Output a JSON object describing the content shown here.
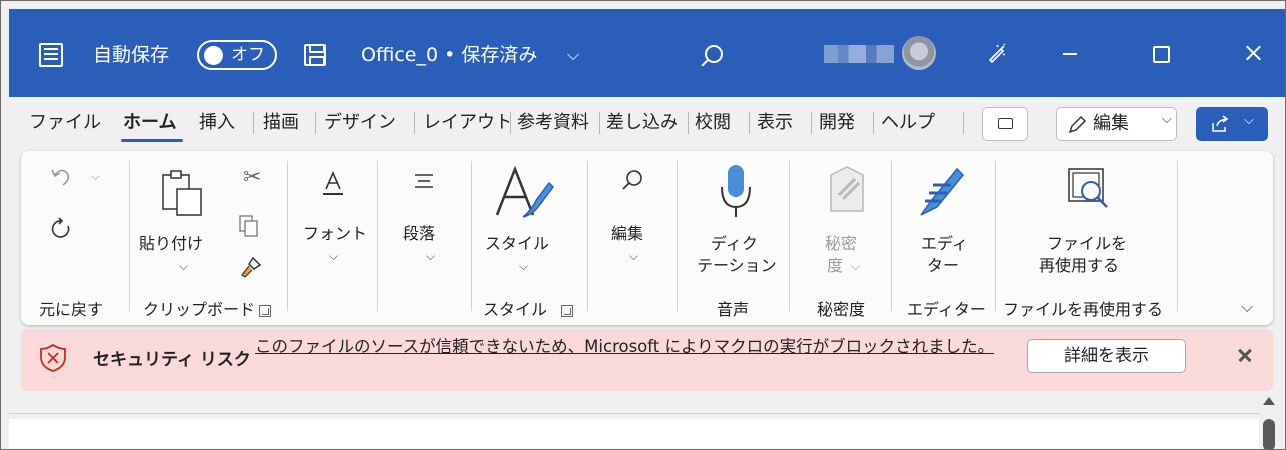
{
  "titlebar": {
    "autosave_label": "自動保存",
    "toggle_label": "オフ",
    "doc_title": "Office_0 • 保存済み",
    "doc_title_chevron": "⌵",
    "accent": "#2b5eb8"
  },
  "tabs": {
    "items": [
      "ファイル",
      "ホーム",
      "挿入",
      "描画",
      "デザイン",
      "レイアウト",
      "参考資料",
      "差し込み",
      "校閲",
      "表示",
      "開発",
      "ヘルプ"
    ],
    "active": "ホーム",
    "edit_label": "編集",
    "icons": [
      "comment-icon",
      "pencil-icon",
      "share-icon"
    ]
  },
  "ribbon": {
    "undo": {
      "group_label": "元に戻す"
    },
    "clipboard": {
      "paste_label": "貼り付け",
      "group_label": "クリップボード"
    },
    "font": {
      "label": "フォント"
    },
    "paragraph": {
      "label": "段落"
    },
    "styles": {
      "label": "スタイル",
      "group_label": "スタイル"
    },
    "editing": {
      "label": "編集"
    },
    "voice": {
      "label_line1": "ディク",
      "label_line2": "テーション",
      "group_label": "音声"
    },
    "sensitivity": {
      "label_line1": "秘密",
      "label_line2": "度",
      "group_label": "秘密度"
    },
    "editor": {
      "label_line1": "エディ",
      "label_line2": "ター",
      "group_label": "エディター"
    },
    "reuse": {
      "label_line1": "ファイルを",
      "label_line2": "再使用する",
      "group_label": "ファイルを再使用する"
    }
  },
  "security": {
    "title": "セキュリティ リスク",
    "message": "このファイルのソースが信頼できないため、Microsoft によりマクロの実行がブロックされました。",
    "details_button": "詳細を表示",
    "color": "#f9d9d9"
  }
}
